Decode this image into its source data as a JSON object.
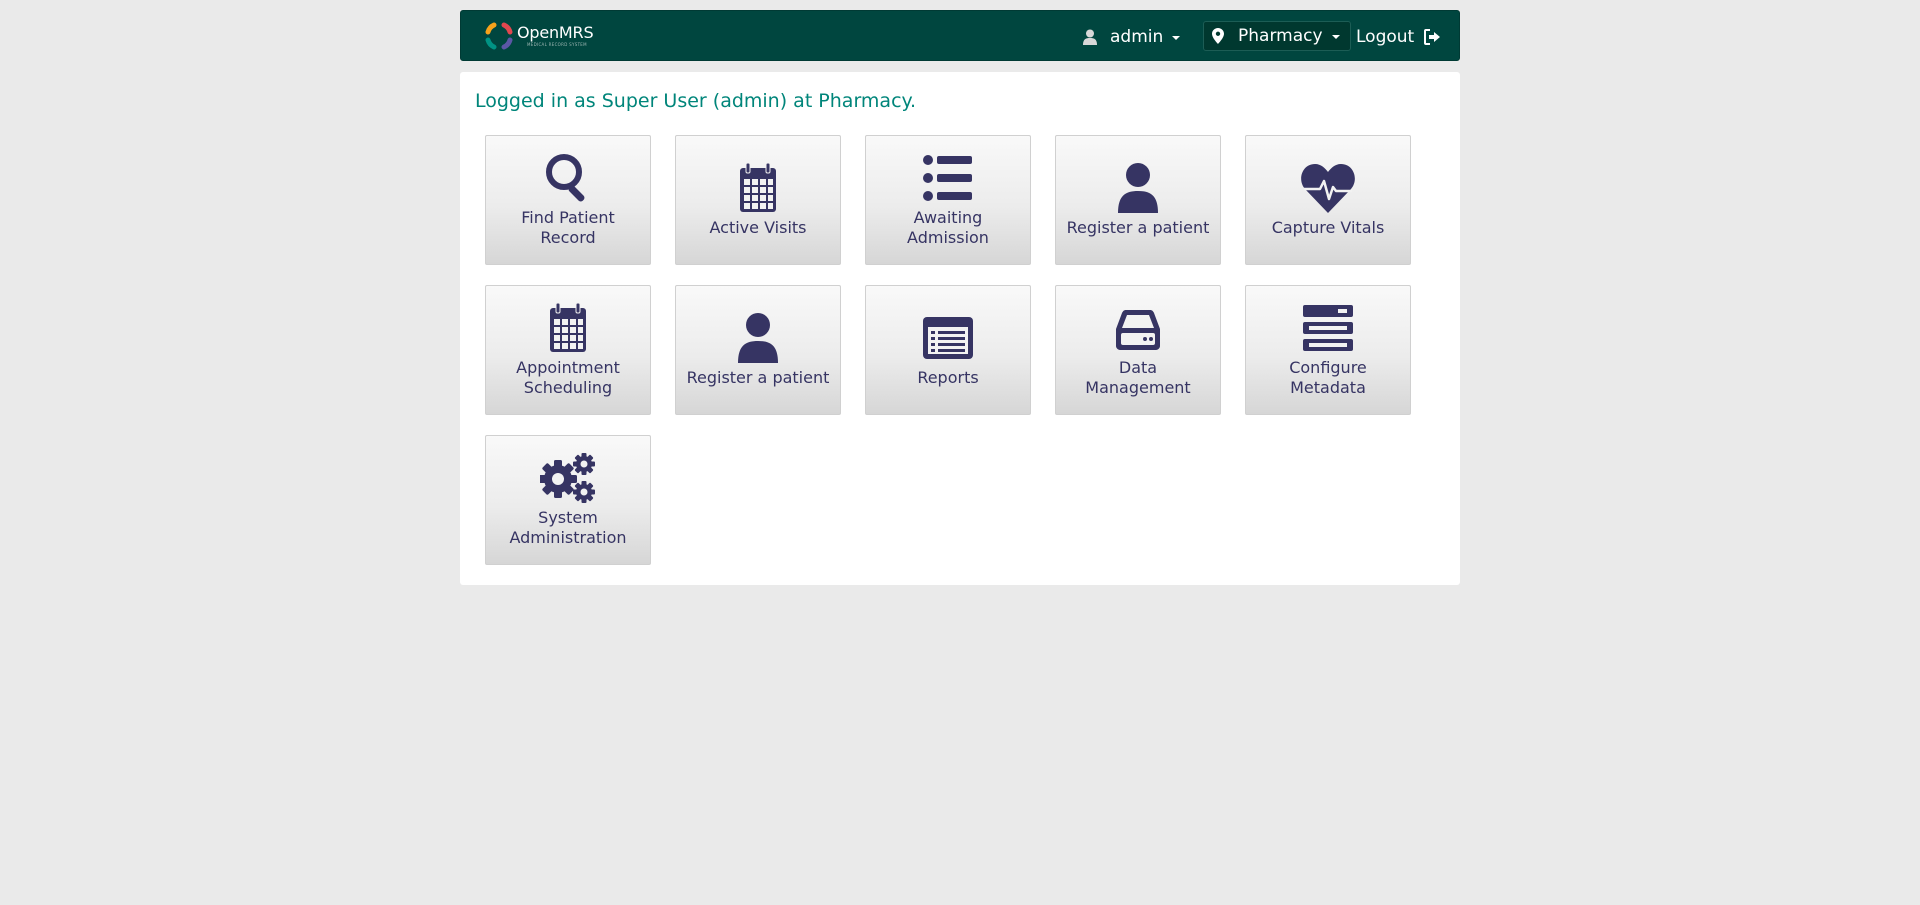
{
  "header": {
    "logo_text": "OpenMRS",
    "logo_subtext": "MEDICAL RECORD SYSTEM",
    "user_label": "admin",
    "location_label": "Pharmacy",
    "logout_label": "Logout",
    "colors": {
      "header_bg": "#00463f",
      "accent_text": "#00857a",
      "tile_text": "#363463"
    }
  },
  "main": {
    "welcome_message": "Logged in as Super User (admin) at Pharmacy.",
    "apps": [
      {
        "label": "Find Patient Record",
        "icon": "search-icon"
      },
      {
        "label": "Active Visits",
        "icon": "calendar-icon"
      },
      {
        "label": "Awaiting Admission",
        "icon": "list-icon"
      },
      {
        "label": "Register a patient",
        "icon": "user-icon"
      },
      {
        "label": "Capture Vitals",
        "icon": "heartbeat-icon"
      },
      {
        "label": "Appointment Scheduling",
        "icon": "calendar-icon"
      },
      {
        "label": "Register a patient",
        "icon": "user-icon"
      },
      {
        "label": "Reports",
        "icon": "report-list-icon"
      },
      {
        "label": "Data Management",
        "icon": "hard-drive-icon"
      },
      {
        "label": "Configure Metadata",
        "icon": "server-icon"
      },
      {
        "label": "System Administration",
        "icon": "gears-icon"
      }
    ]
  }
}
